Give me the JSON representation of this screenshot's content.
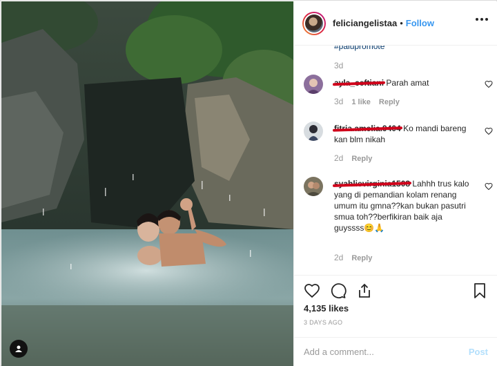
{
  "post": {
    "photo_alt_icon": "user-tag-icon"
  },
  "header": {
    "username": "feliciangelistaa",
    "separator": "•",
    "follow_label": "Follow"
  },
  "caption": {
    "tail_text": "#palupromote",
    "time": "3d"
  },
  "comments": [
    {
      "username": "ayla_ceftiani",
      "text": "Parah amat",
      "time": "3d",
      "likes": "1 like",
      "reply_label": "Reply"
    },
    {
      "username": "fitria.amelia.9404",
      "text": "Ko mandi bareng kan blm nikah",
      "time": "2d",
      "likes": "",
      "reply_label": "Reply"
    },
    {
      "username": "syahlievirginia1508",
      "text": "Lahhh trus kalo yang di pemandian kolam renang umum itu gmna??kan bukan pasutri smua toh??berfikiran baik aja guyssss😊🙏",
      "time": "2d",
      "likes": "",
      "reply_label": "Reply"
    }
  ],
  "actions": {
    "like_icon": "heart-icon",
    "comment_icon": "comment-icon",
    "share_icon": "share-icon",
    "save_icon": "bookmark-icon",
    "likes_count": "4,135 likes",
    "date": "3 DAYS AGO"
  },
  "add_comment": {
    "placeholder": "Add a comment...",
    "post_label": "Post"
  },
  "colors": {
    "accent": "#3897f0",
    "text": "#262626",
    "muted": "#999999",
    "border": "#efefef",
    "redaction": "#d0021b"
  }
}
